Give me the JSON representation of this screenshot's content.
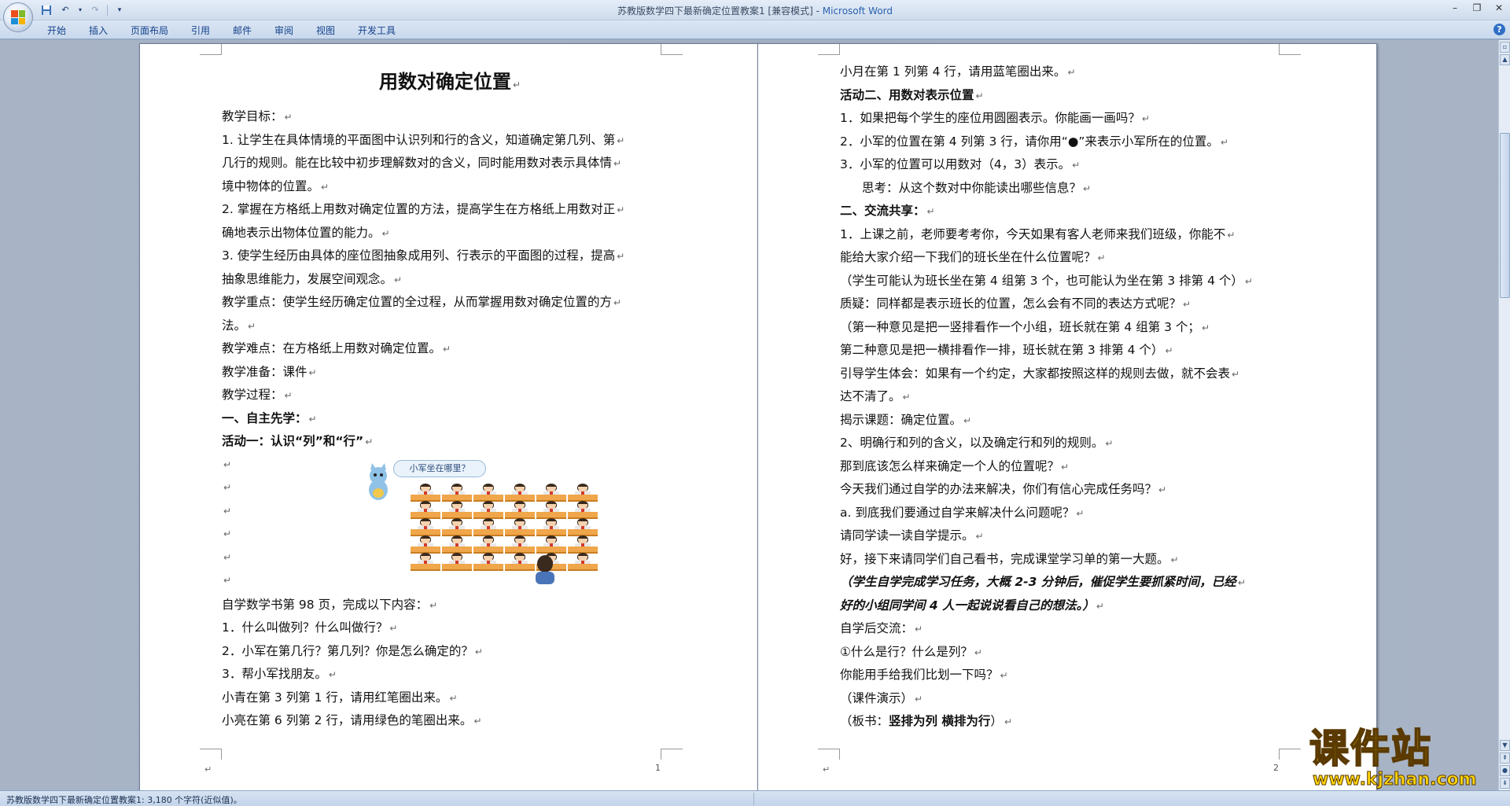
{
  "window": {
    "title": "苏教版数学四下最新确定位置教案1 [兼容模式] - ",
    "app_name": "Microsoft Word"
  },
  "qat": {
    "icons": [
      "save-icon",
      "undo-icon",
      "redo-icon",
      "customize-icon"
    ]
  },
  "ribbon": {
    "tabs": [
      "开始",
      "插入",
      "页面布局",
      "引用",
      "邮件",
      "审阅",
      "视图",
      "开发工具"
    ]
  },
  "page1": {
    "title": "用数对确定位置",
    "lines_top": [
      {
        "t": "教学目标：",
        "s": ""
      },
      {
        "t": "1. 让学生在具体情境的平面图中认识列和行的含义，知道确定第几列、第",
        "s": ""
      },
      {
        "t": "几行的规则。能在比较中初步理解数对的含义，同时能用数对表示具体情",
        "s": ""
      },
      {
        "t": "境中物体的位置。",
        "s": ""
      },
      {
        "t": "2. 掌握在方格纸上用数对确定位置的方法，提高学生在方格纸上用数对正",
        "s": ""
      },
      {
        "t": "确地表示出物体位置的能力。",
        "s": ""
      },
      {
        "t": "3. 使学生经历由具体的座位图抽象成用列、行表示的平面图的过程，提高",
        "s": ""
      },
      {
        "t": "抽象思维能力，发展空间观念。",
        "s": ""
      },
      {
        "t": "教学重点：使学生经历确定位置的全过程，从而掌握用数对确定位置的方",
        "s": ""
      },
      {
        "t": "法。",
        "s": ""
      },
      {
        "t": "教学难点：在方格纸上用数对确定位置。",
        "s": ""
      },
      {
        "t": "教学准备：课件",
        "s": ""
      },
      {
        "t": "教学过程：",
        "s": ""
      },
      {
        "t": "一、自主先学：",
        "s": "b"
      },
      {
        "t": "活动一：认识“列”和“行”",
        "s": "b"
      }
    ],
    "bubble": "小军坐在哪里？",
    "lines_bottom": [
      {
        "t": "自学数学书第 98 页，完成以下内容：",
        "s": ""
      },
      {
        "t": "1．什么叫做列？什么叫做行？",
        "s": ""
      },
      {
        "t": "2．小军在第几行？第几列？你是怎么确定的？",
        "s": ""
      },
      {
        "t": "3．帮小军找朋友。",
        "s": ""
      },
      {
        "t": "小青在第 3 列第 1 行，请用红笔圈出来。",
        "s": ""
      },
      {
        "t": "小亮在第 6 列第 2 行，请用绿色的笔圈出来。",
        "s": ""
      }
    ],
    "page_number": "1"
  },
  "page2": {
    "lines": [
      {
        "t": "小月在第 1 列第 4 行，请用蓝笔圈出来。",
        "s": ""
      },
      {
        "t": "活动二、用数对表示位置",
        "s": "b"
      },
      {
        "t": "1．如果把每个学生的座位用圆圈表示。你能画一画吗？",
        "s": ""
      },
      {
        "t": "2．小军的位置在第 4 列第 3 行，请你用“●”来表示小军所在的位置。",
        "s": ""
      },
      {
        "t": "3．小军的位置可以用数对（4，3）表示。",
        "s": ""
      },
      {
        "t": "思考：从这个数对中你能读出哪些信息？",
        "s": "indent"
      },
      {
        "t": "二、交流共享：",
        "s": "b"
      },
      {
        "t": "1．上课之前，老师要考考你，今天如果有客人老师来我们班级，你能不",
        "s": ""
      },
      {
        "t": "能给大家介绍一下我们的班长坐在什么位置呢？",
        "s": ""
      },
      {
        "t": "（学生可能认为班长坐在第 4 组第 3 个，也可能认为坐在第 3 排第 4 个）",
        "s": ""
      },
      {
        "t": "质疑：同样都是表示班长的位置，怎么会有不同的表达方式呢？",
        "s": ""
      },
      {
        "t": "（第一种意见是把一竖排看作一个小组，班长就在第 4 组第 3 个；",
        "s": ""
      },
      {
        "t": "第二种意见是把一横排看作一排，班长就在第 3 排第 4 个）",
        "s": ""
      },
      {
        "t": "引导学生体会：如果有一个约定，大家都按照这样的规则去做，就不会表",
        "s": ""
      },
      {
        "t": "达不清了。",
        "s": ""
      },
      {
        "t": "揭示课题：确定位置。",
        "s": ""
      },
      {
        "t": "2、明确行和列的含义，以及确定行和列的规则。",
        "s": ""
      },
      {
        "t": "那到底该怎么样来确定一个人的位置呢？",
        "s": ""
      },
      {
        "t": "今天我们通过自学的办法来解决，你们有信心完成任务吗？",
        "s": ""
      },
      {
        "t": "a. 到底我们要通过自学来解决什么问题呢？",
        "s": ""
      },
      {
        "t": "请同学读一读自学提示。",
        "s": ""
      },
      {
        "t": "好，接下来请同学们自己看书，完成课堂学习单的第一大题。",
        "s": ""
      },
      {
        "t": "（学生自学完成学习任务，大概 2-3 分钟后，催促学生要抓紧时间，已经",
        "s": "i"
      },
      {
        "t": "好的小组同学间 4 人一起说说看自己的想法。）",
        "s": "i"
      },
      {
        "t": "自学后交流：",
        "s": ""
      },
      {
        "t": "①什么是行？什么是列？",
        "s": ""
      },
      {
        "t": "你能用手给我们比划一下吗？",
        "s": ""
      },
      {
        "t": "（课件演示）",
        "s": ""
      }
    ],
    "last_line_prefix": "（板书：",
    "last_line_bold": "竖排为列 横排为行",
    "last_line_suffix": "）",
    "page_number": "2"
  },
  "statusbar": {
    "text": "苏教版数学四下最新确定位置教案1: 3,180 个字符(近似值)。"
  },
  "watermark": {
    "title": "课件站",
    "url": "www.kjzhan.com"
  },
  "colors": {
    "accent": "#2a62b0",
    "tab_text": "#15428b",
    "watermark": "#ffd60a"
  }
}
